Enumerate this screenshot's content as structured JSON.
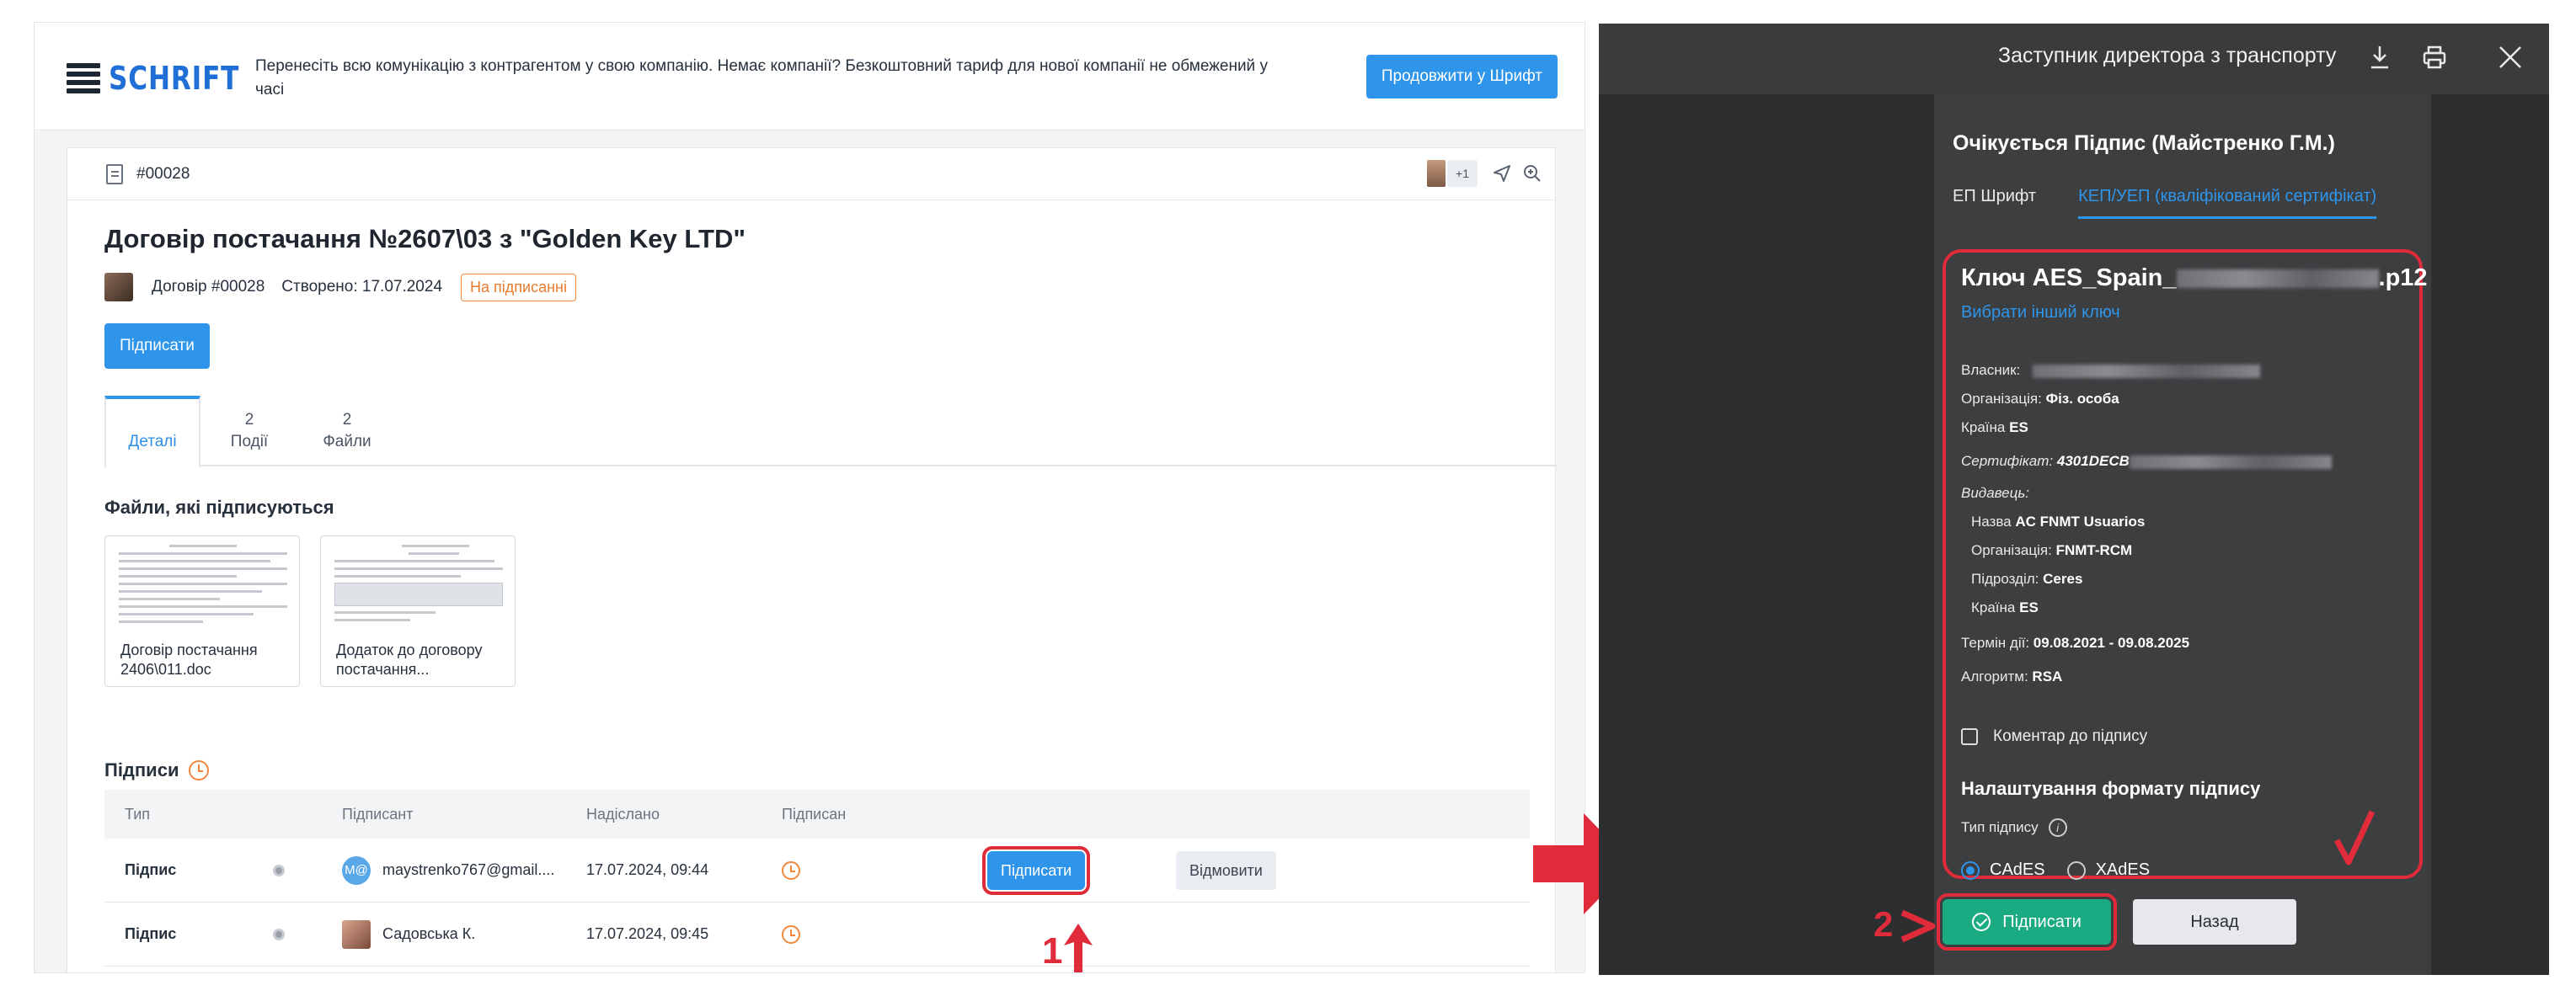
{
  "promo": {
    "logo": "SCHRIFT",
    "text": "Перенесіть всю комунікацію з контрагентом у свою компанію. Немає компанії? Безкоштовний тариф для нової компанії не обмежений у часі",
    "button": "Продовжити у Шрифт"
  },
  "doc_bar": {
    "number": "#00028",
    "participants_extra": "+1"
  },
  "document": {
    "title": "Договір постачання №2607\\03 з \"Golden Key LTD\"",
    "type_label": "Договір #00028",
    "created": "Створено: 17.07.2024",
    "status": "На підписанні",
    "sign_button": "Підписати"
  },
  "tabs": [
    {
      "count": "",
      "label": "Деталі"
    },
    {
      "count": "2",
      "label": "Події"
    },
    {
      "count": "2",
      "label": "Файли"
    }
  ],
  "files_section": {
    "heading": "Файли, які підписуються",
    "files": [
      {
        "name": "Договір постачання 2406\\011.doc"
      },
      {
        "name": "Додаток до договору постачання..."
      }
    ]
  },
  "signatures": {
    "heading": "Підписи",
    "columns": [
      "Тип",
      "Підписант",
      "Надіслано",
      "Підписан"
    ],
    "rows": [
      {
        "type": "Підпис",
        "avatar_text": "M@",
        "signer": "maystrenko767@gmail....",
        "sent": "17.07.2024, 09:44",
        "sign_btn": "Підписати",
        "reject_btn": "Відмовити"
      },
      {
        "type": "Підпис",
        "avatar_text": "",
        "signer": "Садовська К.",
        "sent": "17.07.2024, 09:45"
      }
    ]
  },
  "annotations": {
    "step1": "1",
    "step2": "2"
  },
  "dialog": {
    "title": "Заступник директора з транспорту",
    "heading": "Очікується Підпис (Майстренко Г.М.)",
    "tabs": [
      "ЕП Шрифт",
      "КЕП/УЕП (кваліфікований сертифікат)"
    ],
    "key_prefix": "Ключ AES_Spain_",
    "key_suffix": ".p12",
    "choose_key": "Вибрати інший ключ",
    "owner_label": "Власник:",
    "org_label": "Організація:",
    "org_value": "Фіз. особа",
    "country_label": "Країна",
    "country_value": "ES",
    "cert_label": "Сертифікат:",
    "cert_value": "4301DECB",
    "issuer_label": "Видавець:",
    "issuer_name_label": "Назва",
    "issuer_name_value": "AC FNMT Usuarios",
    "issuer_org_label": "Організація:",
    "issuer_org_value": "FNMT-RCM",
    "issuer_unit_label": "Підрозділ:",
    "issuer_unit_value": "Ceres",
    "issuer_country_label": "Країна",
    "issuer_country_value": "ES",
    "validity_label": "Термін дії:",
    "validity_value": "09.08.2021 - 09.08.2025",
    "algo_label": "Алгоритм:",
    "algo_value": "RSA",
    "comment": "Коментар до підпису",
    "format_heading": "Налаштування формату підпису",
    "format_type": "Тип підпису",
    "radio_cades": "CAdES",
    "radio_xades": "XAdES",
    "sign_button": "Підписати",
    "back_button": "Назад"
  },
  "colors": {
    "accent": "#2f95ea",
    "danger": "#e02b3a",
    "warning": "#f0883e",
    "success": "#1bab82"
  }
}
